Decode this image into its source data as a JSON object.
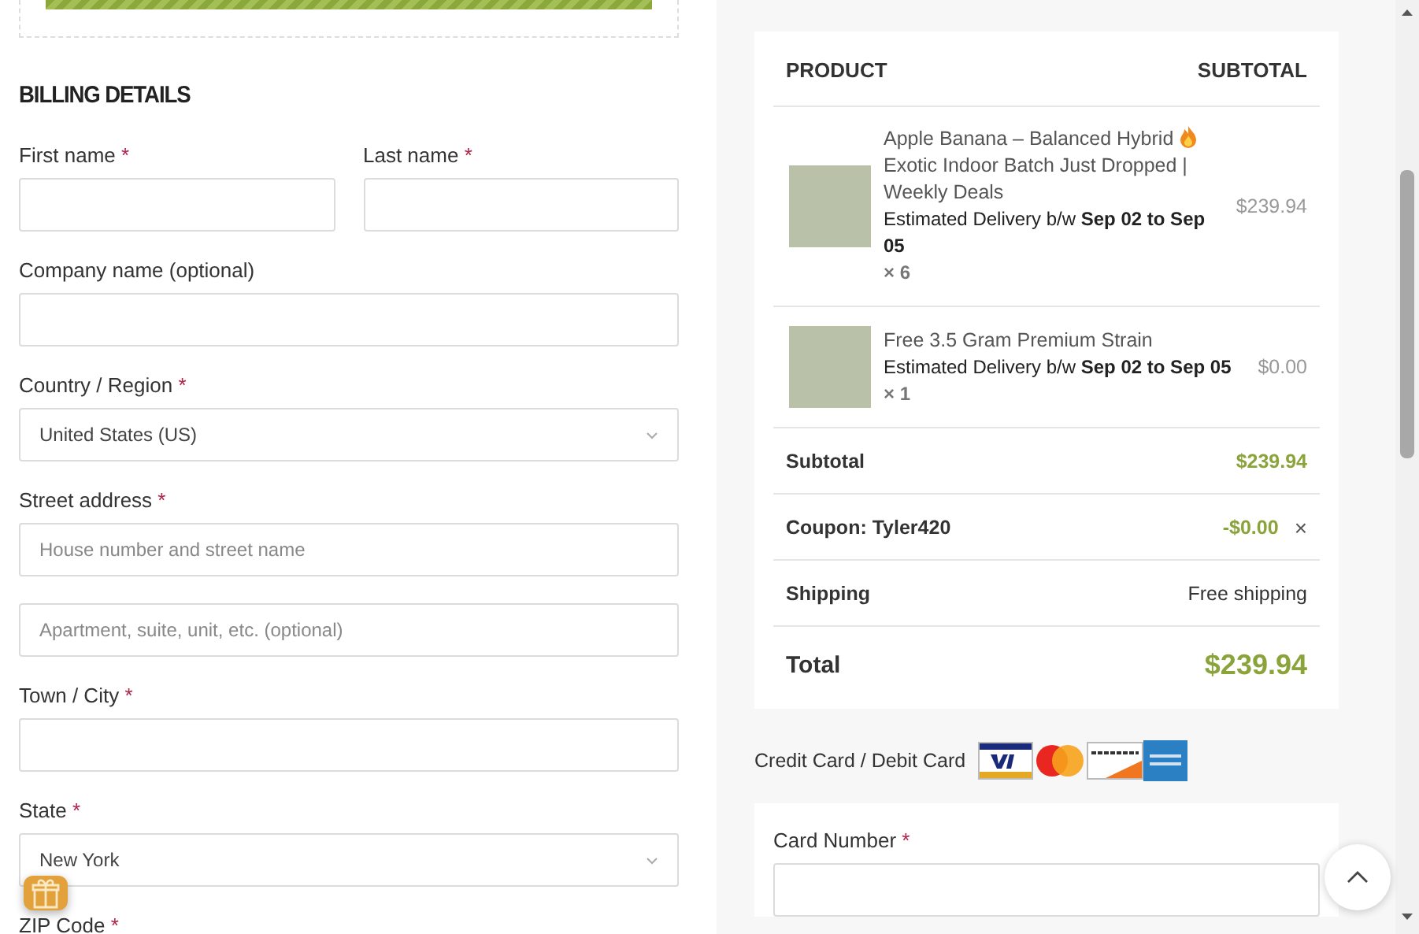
{
  "progress": {
    "level": 1
  },
  "billing": {
    "heading": "BILLING DETAILS",
    "fields": [
      {
        "kind": "text",
        "label": "First name",
        "required_mark": "*",
        "half": true
      },
      {
        "kind": "text",
        "label": "Last name",
        "required_mark": "*",
        "half": true
      },
      {
        "kind": "text",
        "label": "Company name (optional)",
        "half": false
      },
      {
        "kind": "select",
        "label": "Country / Region",
        "required_mark": "*",
        "half": false,
        "value": "United States (US)"
      },
      {
        "kind": "text",
        "label": "Street address",
        "required_mark": "*",
        "half": false,
        "placeholder": "House number and street name"
      },
      {
        "kind": "text",
        "half": false,
        "placeholder": "Apartment, suite, unit, etc. (optional)"
      },
      {
        "kind": "text",
        "label": "Town / City",
        "required_mark": "*",
        "half": false
      },
      {
        "kind": "select",
        "label": "State",
        "required_mark": "*",
        "half": false,
        "value": "New York"
      },
      {
        "kind": "text",
        "label": "ZIP Code",
        "required_mark": "*"
      }
    ]
  },
  "order": {
    "columns": [
      "PRODUCT",
      "SUBTOTAL"
    ],
    "items": [
      {
        "name": "Apple Banana – Balanced Hybrid",
        "hot": true,
        "name_continued": "Exotic Indoor Batch Just Dropped | Weekly Deals",
        "delivery": "Estimated Delivery b/w **Sep 02 to Sep 05**",
        "quantity": "× 6",
        "price": "$239.94"
      },
      {
        "name": "Free 3.5 Gram Premium Strain",
        "hot": false,
        "delivery": "Estimated Delivery b/w **Sep 02 to Sep 05**",
        "quantity": "× 1",
        "price": "$0.00"
      }
    ],
    "totals": [
      {
        "kind": "subtotal",
        "label": "Subtotal",
        "value": "$239.94"
      },
      {
        "kind": "coupon",
        "label": "Coupon: Tyler420",
        "value": "-$0.00",
        "remove": "×"
      },
      {
        "kind": "shipping",
        "label": "Shipping",
        "value": "Free shipping"
      },
      {
        "kind": "total",
        "label": "Total",
        "value": "$239.94"
      }
    ]
  },
  "payment": {
    "method": "Credit Card / Debit Card",
    "cards": [
      {
        "kind": "visa"
      },
      {
        "kind": "mastercard"
      },
      {
        "kind": "discover"
      },
      {
        "kind": "amex"
      }
    ],
    "fields": [
      {
        "kind": "text",
        "label": "Card Number",
        "required_mark": "*"
      }
    ]
  }
}
